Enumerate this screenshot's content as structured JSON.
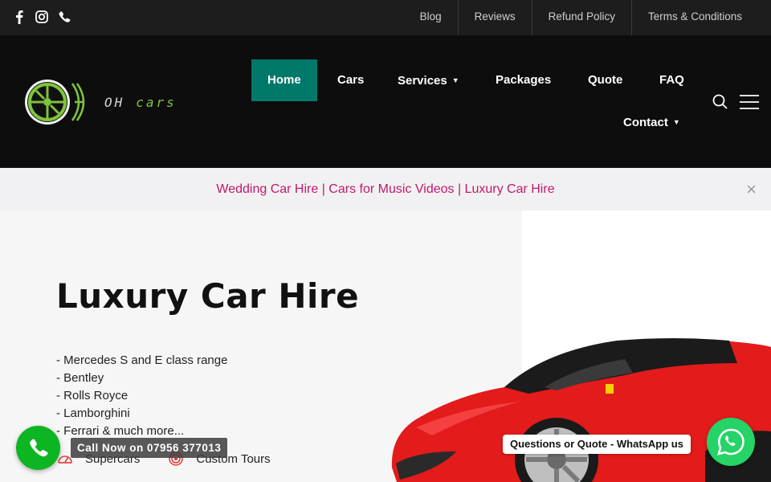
{
  "topbar": {
    "social": [
      {
        "icon": "facebook-icon"
      },
      {
        "icon": "instagram-icon"
      },
      {
        "icon": "phone-icon"
      }
    ],
    "links": [
      "Blog",
      "Reviews",
      "Refund Policy",
      "Terms & Conditions"
    ]
  },
  "logo": {
    "text_left": "OH",
    "text_right": "cars"
  },
  "nav": {
    "items": [
      {
        "label": "Home",
        "active": true
      },
      {
        "label": "Cars"
      },
      {
        "label": "Services",
        "has_dropdown": true
      },
      {
        "label": "Packages"
      },
      {
        "label": "Quote"
      },
      {
        "label": "FAQ"
      },
      {
        "label": "Contact",
        "has_dropdown": true
      }
    ],
    "active_color": "#00796b"
  },
  "announcement": {
    "text": "Wedding Car Hire | Cars for Music Videos | Luxury Car Hire",
    "close": "×",
    "color": "#c2186b"
  },
  "hero": {
    "title": "Luxury Car Hire",
    "list": [
      "- Mercedes S and E class range",
      "- Bentley",
      "- Rolls Royce",
      "- Lamborghini",
      "- Ferrari & much more..."
    ],
    "features": [
      {
        "label": "Supercars",
        "icon": "speedometer-icon"
      },
      {
        "label": "Custom Tours",
        "icon": "target-icon"
      }
    ]
  },
  "call_widget": {
    "label": "Call Now on 07956 377013",
    "color": "#0eb522"
  },
  "whatsapp_widget": {
    "label": "Questions or Quote - WhatsApp us",
    "color": "#25d366"
  }
}
